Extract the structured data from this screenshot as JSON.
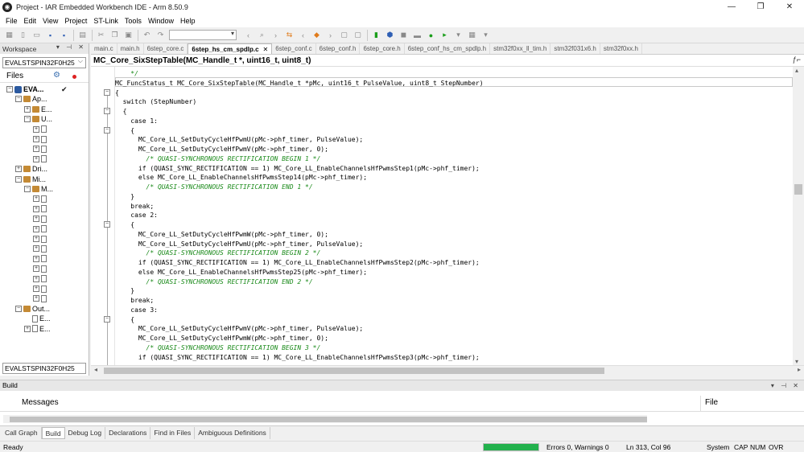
{
  "window": {
    "title": "Project - IAR Embedded Workbench IDE - Arm 8.50.9",
    "minimize": "—",
    "restore": "❐",
    "close": "✕"
  },
  "menu": [
    "File",
    "Edit",
    "View",
    "Project",
    "ST-Link",
    "Tools",
    "Window",
    "Help"
  ],
  "workspace": {
    "title": "Workspace",
    "config": "EVALSTSPIN32F0H25",
    "files_label": "Files",
    "footer": "EVALSTSPIN32F0H25",
    "tree": [
      {
        "label": "EVA...",
        "depth": 0,
        "type": "project",
        "expander": "−",
        "bold": true
      },
      {
        "label": "Ap...",
        "depth": 1,
        "type": "folder",
        "expander": "−"
      },
      {
        "label": "E...",
        "depth": 2,
        "type": "folder",
        "expander": "+"
      },
      {
        "label": "U...",
        "depth": 2,
        "type": "folder",
        "expander": "−"
      },
      {
        "label": "",
        "depth": 3,
        "type": "file",
        "expander": "+"
      },
      {
        "label": "",
        "depth": 3,
        "type": "file",
        "expander": "+"
      },
      {
        "label": "",
        "depth": 3,
        "type": "file",
        "expander": "+"
      },
      {
        "label": "",
        "depth": 3,
        "type": "file",
        "expander": "+"
      },
      {
        "label": "Dri...",
        "depth": 1,
        "type": "folder",
        "expander": "+"
      },
      {
        "label": "Mi...",
        "depth": 1,
        "type": "folder",
        "expander": "−"
      },
      {
        "label": "M...",
        "depth": 2,
        "type": "folder",
        "expander": "−"
      },
      {
        "label": "",
        "depth": 3,
        "type": "file",
        "expander": "+"
      },
      {
        "label": "",
        "depth": 3,
        "type": "file",
        "expander": "+"
      },
      {
        "label": "",
        "depth": 3,
        "type": "file",
        "expander": "+"
      },
      {
        "label": "",
        "depth": 3,
        "type": "file",
        "expander": "+"
      },
      {
        "label": "",
        "depth": 3,
        "type": "file",
        "expander": "+"
      },
      {
        "label": "",
        "depth": 3,
        "type": "file",
        "expander": "+"
      },
      {
        "label": "",
        "depth": 3,
        "type": "file",
        "expander": "+"
      },
      {
        "label": "",
        "depth": 3,
        "type": "file",
        "expander": "+"
      },
      {
        "label": "",
        "depth": 3,
        "type": "file",
        "expander": "+"
      },
      {
        "label": "",
        "depth": 3,
        "type": "file",
        "expander": "+"
      },
      {
        "label": "",
        "depth": 3,
        "type": "file",
        "expander": "+"
      },
      {
        "label": "Out...",
        "depth": 1,
        "type": "folder",
        "expander": "−"
      },
      {
        "label": "E...",
        "depth": 2,
        "type": "file",
        "expander": ""
      },
      {
        "label": "E...",
        "depth": 2,
        "type": "file",
        "expander": "+"
      }
    ]
  },
  "tabs": [
    {
      "label": "main.c",
      "active": false
    },
    {
      "label": "main.h",
      "active": false
    },
    {
      "label": "6step_core.c",
      "active": false
    },
    {
      "label": "6step_hs_cm_spdlp.c",
      "active": true
    },
    {
      "label": "6step_conf.c",
      "active": false
    },
    {
      "label": "6step_conf.h",
      "active": false
    },
    {
      "label": "6step_core.h",
      "active": false
    },
    {
      "label": "6step_conf_hs_cm_spdlp.h",
      "active": false
    },
    {
      "label": "stm32f0xx_ll_tim.h",
      "active": false
    },
    {
      "label": "stm32f031x6.h",
      "active": false
    },
    {
      "label": "stm32f0xx.h",
      "active": false
    }
  ],
  "function_bar": "MC_Core_SixStepTable(MC_Handle_t *, uint16_t, uint8_t)",
  "code": [
    {
      "t": "    */",
      "c": "cm"
    },
    {
      "t": "MC_FuncStatus_t MC_Core_SixStepTable(MC_Handle_t *pMc, uint16_t PulseValue, uint8_t StepNumber)",
      "c": ""
    },
    {
      "t": "{",
      "c": ""
    },
    {
      "t": "  switch (StepNumber)",
      "c": "kw"
    },
    {
      "t": "  {",
      "c": ""
    },
    {
      "t": "    case 1:",
      "c": "kw"
    },
    {
      "t": "    {",
      "c": ""
    },
    {
      "t": "      MC_Core_LL_SetDutyCycleHfPwmU(pMc->phf_timer, PulseValue);",
      "c": ""
    },
    {
      "t": "      MC_Core_LL_SetDutyCycleHfPwmV(pMc->phf_timer, 0);",
      "c": ""
    },
    {
      "t": "        /* QUASI-SYNCHRONOUS RECTIFICATION BEGIN 1 */",
      "c": "cm"
    },
    {
      "t": "      if (QUASI_SYNC_RECTIFICATION == 1) MC_Core_LL_EnableChannelsHfPwmsStep1(pMc->phf_timer);",
      "c": ""
    },
    {
      "t": "      else MC_Core_LL_EnableChannelsHfPwmsStep14(pMc->phf_timer);",
      "c": ""
    },
    {
      "t": "        /* QUASI-SYNCHRONOUS RECTIFICATION END 1 */",
      "c": "cm"
    },
    {
      "t": "    }",
      "c": ""
    },
    {
      "t": "    break;",
      "c": "kw"
    },
    {
      "t": "    case 2:",
      "c": "kw"
    },
    {
      "t": "    {",
      "c": ""
    },
    {
      "t": "      MC_Core_LL_SetDutyCycleHfPwmW(pMc->phf_timer, 0);",
      "c": ""
    },
    {
      "t": "      MC_Core_LL_SetDutyCycleHfPwmU(pMc->phf_timer, PulseValue);",
      "c": ""
    },
    {
      "t": "        /* QUASI-SYNCHRONOUS RECTIFICATION BEGIN 2 */",
      "c": "cm"
    },
    {
      "t": "      if (QUASI_SYNC_RECTIFICATION == 1) MC_Core_LL_EnableChannelsHfPwmsStep2(pMc->phf_timer);",
      "c": ""
    },
    {
      "t": "      else MC_Core_LL_EnableChannelsHfPwmsStep25(pMc->phf_timer);",
      "c": ""
    },
    {
      "t": "        /* QUASI-SYNCHRONOUS RECTIFICATION END 2 */",
      "c": "cm"
    },
    {
      "t": "    }",
      "c": ""
    },
    {
      "t": "    break;",
      "c": "kw"
    },
    {
      "t": "    case 3:",
      "c": "kw"
    },
    {
      "t": "    {",
      "c": ""
    },
    {
      "t": "      MC_Core_LL_SetDutyCycleHfPwmV(pMc->phf_timer, PulseValue);",
      "c": ""
    },
    {
      "t": "      MC_Core_LL_SetDutyCycleHfPwmW(pMc->phf_timer, 0);",
      "c": ""
    },
    {
      "t": "        /* QUASI-SYNCHRONOUS RECTIFICATION BEGIN 3 */",
      "c": "cm"
    },
    {
      "t": "      if (QUASI_SYNC_RECTIFICATION == 1) MC_Core_LL_EnableChannelsHfPwmsStep3(pMc->phf_timer);",
      "c": ""
    }
  ],
  "fold_rows": [
    2,
    4,
    6,
    16,
    26
  ],
  "build": {
    "title": "Build",
    "col_messages": "Messages",
    "col_file": "File"
  },
  "bottom_tabs": [
    {
      "label": "Call Graph",
      "active": false
    },
    {
      "label": "Build",
      "active": true
    },
    {
      "label": "Debug Log",
      "active": false
    },
    {
      "label": "Declarations",
      "active": false
    },
    {
      "label": "Find in Files",
      "active": false
    },
    {
      "label": "Ambiguous Definitions",
      "active": false
    }
  ],
  "status": {
    "ready": "Ready",
    "errors": "Errors 0, Warnings 0",
    "position": "Ln 313, Col 96",
    "system": "System",
    "cap": "CAP",
    "num": "NUM",
    "ovr": "OVR",
    "progress_fraction": 1.0
  }
}
